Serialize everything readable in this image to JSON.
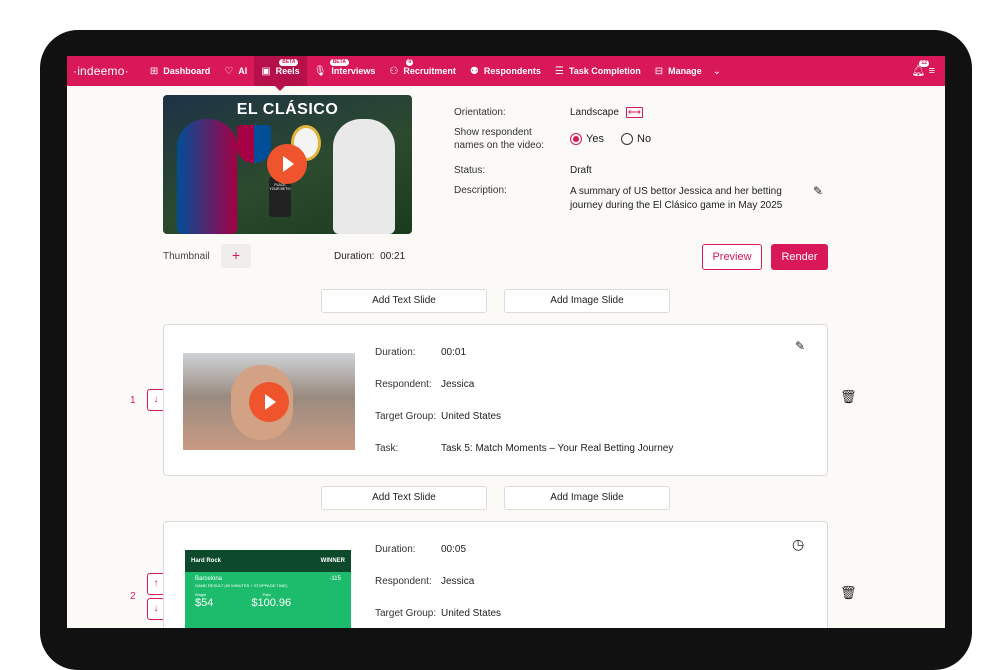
{
  "nav": {
    "logo": "·indeemo·",
    "items": [
      {
        "label": "Dashboard",
        "icon": "grid-icon"
      },
      {
        "label": "AI",
        "icon": "bulb-icon"
      },
      {
        "label": "Reels",
        "icon": "reel-icon",
        "badge": "BETA"
      },
      {
        "label": "Interviews",
        "icon": "mic-icon",
        "badge": "BETA"
      },
      {
        "label": "Recruitment",
        "icon": "people-add-icon",
        "badge": "0"
      },
      {
        "label": "Respondents",
        "icon": "people-icon"
      },
      {
        "label": "Task Completion",
        "icon": "list-check-icon"
      },
      {
        "label": "Manage",
        "icon": "briefcase-icon"
      }
    ],
    "notifications_count": "12",
    "accent": "#d9185a"
  },
  "reel": {
    "thumbnail_title": "EL CLÁSICO",
    "phone_text": "PLACE YOUR BETS!",
    "orientation_label": "Orientation:",
    "orientation_value": "Landscape",
    "show_names_label_line1": "Show respondent",
    "show_names_label_line2": "names on the video:",
    "yes_label": "Yes",
    "no_label": "No",
    "selected": "Yes",
    "status_label": "Status:",
    "status_value": "Draft",
    "description_label": "Description:",
    "description_value": "A summary of US bettor Jessica and her betting journey during the El Clásico game in May 2025",
    "thumbnail_label": "Thumbnail",
    "add_thumbnail": "+",
    "duration_label": "Duration:",
    "duration_value": "00:21",
    "preview_label": "Preview",
    "render_label": "Render"
  },
  "add_text_slide": "Add Text Slide",
  "add_image_slide": "Add Image Slide",
  "slides": [
    {
      "number": "1",
      "duration_label": "Duration:",
      "duration": "00:01",
      "respondent_label": "Respondent:",
      "respondent": "Jessica",
      "target_group_label": "Target Group:",
      "target_group": "United States",
      "task_label": "Task:",
      "task": "Task 5: Match Moments – Your Real Betting Journey"
    },
    {
      "number": "2",
      "duration_label": "Duration:",
      "duration": "00:05",
      "respondent_label": "Respondent:",
      "respondent": "Jessica",
      "target_group_label": "Target Group:",
      "target_group": "United States",
      "bet": {
        "brand": "Hard Rock",
        "status": "WINNER",
        "team": "Barcelona",
        "odds": "-115",
        "market": "GAME RESULT (90 MINUTES + STOPPAGE TIME)",
        "wager_label": "Wager",
        "wager": "$54",
        "paid_label": "Paid",
        "paid": "$100.96"
      }
    }
  ]
}
